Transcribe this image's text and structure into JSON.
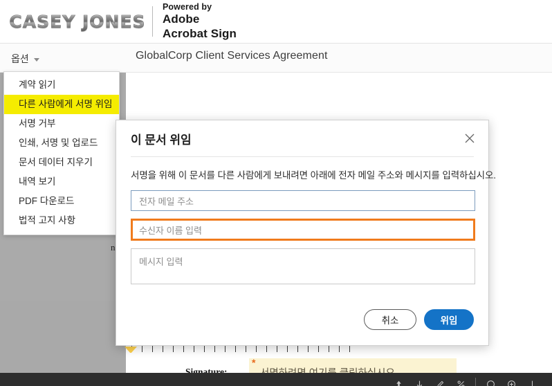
{
  "brand": {
    "logo_text": "CASEY JONES",
    "powered_by": "Powered by",
    "adobe": "Adobe",
    "product": "Acrobat Sign"
  },
  "toolbar": {
    "options_label": "옵션",
    "document_title": "GlobalCorp Client Services Agreement"
  },
  "options_menu": {
    "items": [
      {
        "label": "계약 읽기",
        "highlighted": false
      },
      {
        "label": "다른 사람에게 서명 위임",
        "highlighted": true
      },
      {
        "label": "서명 거부",
        "highlighted": false
      },
      {
        "label": "인쇄, 서명 및 업로드",
        "highlighted": false
      },
      {
        "label": "문서 데이터 지우기",
        "highlighted": false
      },
      {
        "label": "내역 보기",
        "highlighted": false
      },
      {
        "label": "PDF 다운로드",
        "highlighted": false
      },
      {
        "label": "법적 고지 사항",
        "highlighted": false
      }
    ]
  },
  "modal": {
    "title": "이 문서 위임",
    "close_label": "×",
    "description": "서명을 위해 이 문서를 다른 사람에게 보내려면 아래에 전자 메일 주소와 메시지를 입력하십시오.",
    "email_field": {
      "value": "",
      "placeholder": "전자 메일 주소"
    },
    "name_field": {
      "value": "",
      "placeholder": "수신자 이름 입력",
      "focused": true
    },
    "message_field": {
      "value": "",
      "placeholder": "메시지 입력"
    },
    "cancel_label": "취소",
    "submit_label": "위임",
    "accent_color": "#1473c7",
    "focus_color": "#f07b1d"
  },
  "document": {
    "lines": [
      "n",
      "n",
      "n"
    ],
    "signature_label": "Signature:",
    "signature_required_mark": "*",
    "signature_placeholder": "서명하려면 여기를 클릭하십시오",
    "signature_highlight_color": "#fbf3d2"
  },
  "bottom_bar": {
    "icons": [
      "upload-icon",
      "download-icon",
      "pen-icon",
      "percent-icon",
      "separator",
      "zoom-out-icon",
      "zoom-in-icon",
      "fit-icon"
    ]
  }
}
